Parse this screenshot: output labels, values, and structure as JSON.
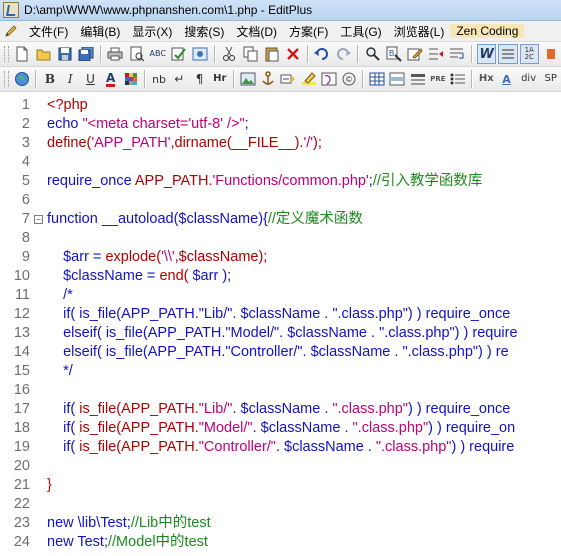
{
  "window": {
    "title": "D:\\amp\\WWW\\www.phpnanshen.com\\1.php - EditPlus"
  },
  "menu": {
    "items": [
      {
        "label": "文件(F)"
      },
      {
        "label": "编辑(B)"
      },
      {
        "label": "显示(X)"
      },
      {
        "label": "搜索(S)"
      },
      {
        "label": "文档(D)"
      },
      {
        "label": "方案(F)"
      },
      {
        "label": "工具(G)"
      },
      {
        "label": "浏览器(L)"
      },
      {
        "label": "Zen Coding"
      }
    ]
  },
  "toolbar2": {
    "bold": "B",
    "italic": "I",
    "underline": "U",
    "font_color": "A",
    "nbsp": "nb",
    "br": "↵",
    "para": "¶",
    "hr": "Hr",
    "hx": "Hx",
    "a_tag": "A",
    "div_tag": "div",
    "span_tag": "SP"
  },
  "editor": {
    "lines": [
      {
        "n": "1",
        "tokens": [
          {
            "t": "<?php",
            "c": "t-fn"
          }
        ]
      },
      {
        "n": "2",
        "tokens": [
          {
            "t": "echo ",
            "c": "t-kw"
          },
          {
            "t": "\"<meta charset='utf-8' />\"",
            "c": "t-str"
          },
          {
            "t": ";",
            "c": "t-kw"
          }
        ]
      },
      {
        "n": "3",
        "tokens": [
          {
            "t": "define(",
            "c": "t-fn"
          },
          {
            "t": "'APP_PATH'",
            "c": "t-str"
          },
          {
            "t": ",dirname(__FILE__).",
            "c": "t-fn"
          },
          {
            "t": "'/'",
            "c": "t-str"
          },
          {
            "t": ");",
            "c": "t-fn"
          }
        ]
      },
      {
        "n": "4",
        "tokens": []
      },
      {
        "n": "5",
        "tokens": [
          {
            "t": "require_once ",
            "c": "t-kw"
          },
          {
            "t": "APP_PATH.",
            "c": "t-fn"
          },
          {
            "t": "'Functions/common.php'",
            "c": "t-str"
          },
          {
            "t": ";",
            "c": "t-kw"
          },
          {
            "t": "//引入教学函数库",
            "c": "t-cmt"
          }
        ]
      },
      {
        "n": "6",
        "tokens": []
      },
      {
        "n": "7",
        "fold": "−",
        "tokens": [
          {
            "t": "function ",
            "c": "t-kw"
          },
          {
            "t": "__autoload(",
            "c": "t-kw"
          },
          {
            "t": "$className",
            "c": "t-var"
          },
          {
            "t": "){",
            "c": "t-kw"
          },
          {
            "t": "//定义魔术函数",
            "c": "t-cmt"
          }
        ]
      },
      {
        "n": "8",
        "tokens": []
      },
      {
        "n": "9",
        "tokens": [
          {
            "t": "    $arr",
            "c": "t-var"
          },
          {
            "t": " = ",
            "c": "t-kw"
          },
          {
            "t": "explode(",
            "c": "t-fn"
          },
          {
            "t": "'\\\\'",
            "c": "t-str"
          },
          {
            "t": ",$className);",
            "c": "t-fn"
          }
        ]
      },
      {
        "n": "10",
        "tokens": [
          {
            "t": "    $className",
            "c": "t-var"
          },
          {
            "t": " = ",
            "c": "t-kw"
          },
          {
            "t": "end(",
            "c": "t-fn"
          },
          {
            "t": " $arr ",
            "c": "t-var"
          },
          {
            "t": ");",
            "c": "t-kw"
          }
        ]
      },
      {
        "n": "11",
        "tokens": [
          {
            "t": "    /*",
            "c": "t-kw"
          }
        ]
      },
      {
        "n": "12",
        "tokens": [
          {
            "t": "    if( is_file(APP_PATH.\"Lib/\". $className . \".class.php\") ) require_once",
            "c": "t-kw"
          }
        ]
      },
      {
        "n": "13",
        "tokens": [
          {
            "t": "    elseif( is_file(APP_PATH.\"Model/\". $className . \".class.php\") ) require",
            "c": "t-kw"
          }
        ]
      },
      {
        "n": "14",
        "tokens": [
          {
            "t": "    elseif( is_file(APP_PATH.\"Controller/\". $className . \".class.php\") ) re",
            "c": "t-kw"
          }
        ]
      },
      {
        "n": "15",
        "tokens": [
          {
            "t": "    */",
            "c": "t-kw"
          }
        ]
      },
      {
        "n": "16",
        "tokens": []
      },
      {
        "n": "17",
        "tokens": [
          {
            "t": "    if( ",
            "c": "t-kw"
          },
          {
            "t": "is_file(APP_PATH.",
            "c": "t-fn"
          },
          {
            "t": "\"Lib/\"",
            "c": "t-str"
          },
          {
            "t": ". $className . ",
            "c": "t-var"
          },
          {
            "t": "\".class.php\"",
            "c": "t-str"
          },
          {
            "t": ") ) require_once",
            "c": "t-kw"
          }
        ]
      },
      {
        "n": "18",
        "tokens": [
          {
            "t": "    if( ",
            "c": "t-kw"
          },
          {
            "t": "is_file(APP_PATH.",
            "c": "t-fn"
          },
          {
            "t": "\"Model/\"",
            "c": "t-str"
          },
          {
            "t": ". $className . ",
            "c": "t-var"
          },
          {
            "t": "\".class.php\"",
            "c": "t-str"
          },
          {
            "t": ") ) require_on",
            "c": "t-kw"
          }
        ]
      },
      {
        "n": "19",
        "tokens": [
          {
            "t": "    if( ",
            "c": "t-kw"
          },
          {
            "t": "is_file(APP_PATH.",
            "c": "t-fn"
          },
          {
            "t": "\"Controller/\"",
            "c": "t-str"
          },
          {
            "t": ". $className . ",
            "c": "t-var"
          },
          {
            "t": "\".class.php\"",
            "c": "t-str"
          },
          {
            "t": ") ) require",
            "c": "t-kw"
          }
        ]
      },
      {
        "n": "20",
        "tokens": []
      },
      {
        "n": "21",
        "tokens": [
          {
            "t": "}",
            "c": "t-red"
          }
        ]
      },
      {
        "n": "22",
        "tokens": []
      },
      {
        "n": "23",
        "tokens": [
          {
            "t": "new \\lib\\Test;",
            "c": "t-kw"
          },
          {
            "t": "//Lib中的test",
            "c": "t-cmt"
          }
        ]
      },
      {
        "n": "24",
        "tokens": [
          {
            "t": "new Test;",
            "c": "t-kw"
          },
          {
            "t": "//Model中的test",
            "c": "t-cmt"
          }
        ]
      }
    ]
  }
}
